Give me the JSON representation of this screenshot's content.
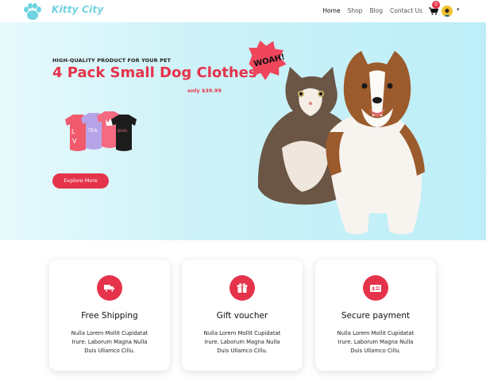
{
  "brand": {
    "name": "Kitty City",
    "logo_icon": "paw-icon",
    "color": "#6fd3e0"
  },
  "nav": {
    "items": [
      {
        "label": "Home",
        "active": true
      },
      {
        "label": "Shop",
        "active": false
      },
      {
        "label": "Blog",
        "active": false
      },
      {
        "label": "Contact Us",
        "active": false
      }
    ],
    "cart_count": "0",
    "user_menu_caret": "▾"
  },
  "hero": {
    "tagline": "HIGH-QUALITY PRODUCT FOR YOUR PET",
    "title": "4 Pack Small Dog Clothes",
    "price": "only $39.99",
    "cta_label": "Explore More",
    "sticker_text": "WOAH!"
  },
  "features": [
    {
      "icon": "delivery-truck-icon",
      "title": "Free Shipping",
      "text": "Nulla Lorem Mollit Cupidatat Irure. Laborum Magna Nulla Duis Ullamco Cillu."
    },
    {
      "icon": "gift-icon",
      "title": "Gift voucher",
      "text": "Nulla Lorem Mollit Cupidatat Irure. Laborum Magna Nulla Duis Ullamco Cillu."
    },
    {
      "icon": "secure-payment-icon",
      "title": "Secure payment",
      "text": "Nulla Lorem Mollit Cupidatat Irure. Laborum Magna Nulla Duis Ullamco Cillu."
    }
  ],
  "colors": {
    "accent": "#e5334b",
    "hero_bg": "#cdf2f8",
    "sticker": "#f0465c"
  }
}
